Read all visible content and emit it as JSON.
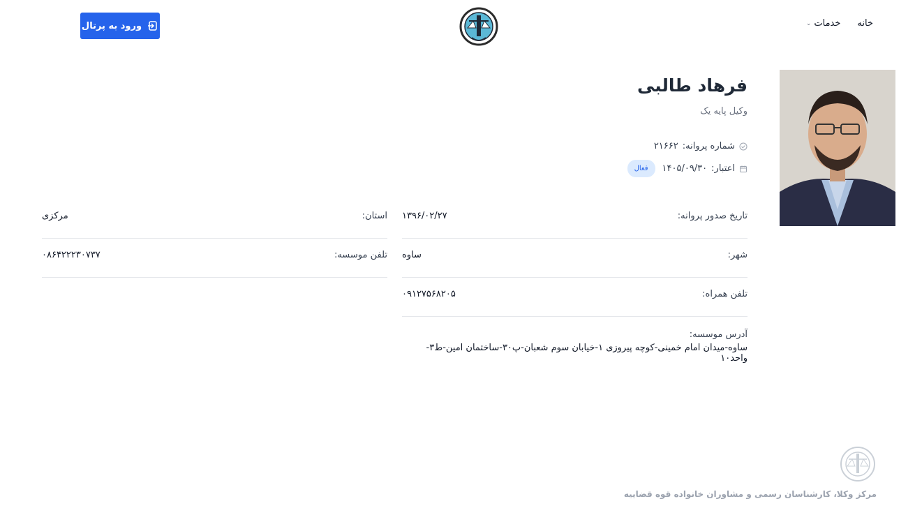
{
  "nav": {
    "home": "خانه",
    "services": "خدمات"
  },
  "portal_button": "ورود به پرتال",
  "profile": {
    "name": "فرهاد طالبی",
    "grade": "وکیل پایه یک",
    "license_label": "شماره پروانه:",
    "license_value": "۲۱۶۶۲",
    "validity_label": "اعتبار:",
    "validity_value": "۱۴۰۵/۰۹/۳۰",
    "status_badge": "فعال"
  },
  "fields": {
    "issue_date": {
      "label": "تاریخ صدور پروانه:",
      "value": "۱۳۹۶/۰۲/۲۷"
    },
    "province": {
      "label": "استان:",
      "value": "مرکزی"
    },
    "city": {
      "label": "شهر:",
      "value": "ساوه"
    },
    "institute_phone": {
      "label": "تلفن موسسه:",
      "value": "۰۸۶۴۲۲۲۳۰۷۳۷"
    },
    "mobile": {
      "label": "تلفن همراه:",
      "value": "۰۹۱۲۷۵۶۸۲۰۵"
    },
    "address": {
      "label": "آدرس موسسه:",
      "value": "ساوه-میدان امام خمینی-کوچه پیروزی ۱-خیابان سوم شعبان-پ۳۰-ساختمان امین-ط۳-واحد۱۰"
    }
  },
  "footer": {
    "text": "مرکز وکلا، کارشناسان رسمی و مشاوران خانواده قوه قضاییه"
  },
  "colors": {
    "primary": "#2563eb",
    "badge_bg": "#dbeafe",
    "border": "#e5e7eb"
  }
}
